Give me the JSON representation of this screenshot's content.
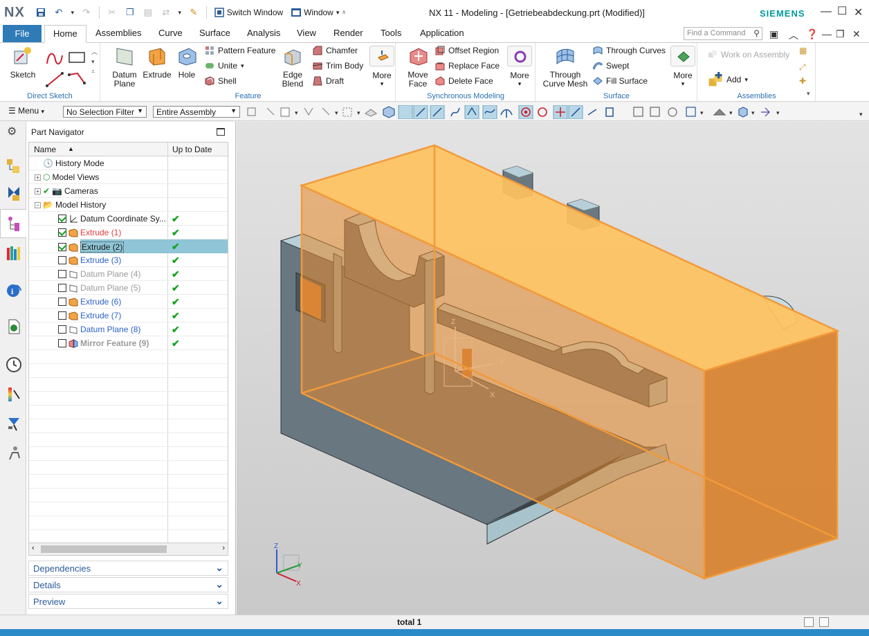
{
  "window": {
    "logo": "NX",
    "title": "NX 11 - Modeling - [Getriebeabdeckung.prt (Modified)]",
    "brand": "SIEMENS",
    "switch_window": "Switch Window",
    "window_menu": "Window",
    "accent_color": "#2e7bb8"
  },
  "tabs": {
    "file": "File",
    "items": [
      "Home",
      "Assemblies",
      "Curve",
      "Surface",
      "Analysis",
      "View",
      "Render",
      "Tools",
      "Application"
    ],
    "active": "Home",
    "find_placeholder": "Find a Command"
  },
  "ribbon": {
    "direct_sketch": {
      "label": "Direct Sketch",
      "sketch": "Sketch"
    },
    "feature": {
      "label": "Feature",
      "datum_plane": "Datum\nPlane",
      "extrude": "Extrude",
      "hole": "Hole",
      "pattern_feature": "Pattern Feature",
      "unite": "Unite",
      "shell": "Shell",
      "edge_blend": "Edge\nBlend",
      "chamfer": "Chamfer",
      "trim_body": "Trim Body",
      "draft": "Draft",
      "more": "More"
    },
    "sync": {
      "label": "Synchronous Modeling",
      "move_face": "Move\nFace",
      "offset_region": "Offset Region",
      "replace_face": "Replace Face",
      "delete_face": "Delete Face",
      "more": "More"
    },
    "surface": {
      "label": "Surface",
      "through_curve_mesh": "Through\nCurve Mesh",
      "through_curves": "Through Curves",
      "swept": "Swept",
      "fill_surface": "Fill Surface",
      "more": "More"
    },
    "assemblies": {
      "label": "Assemblies",
      "work_on_assembly": "Work on Assembly",
      "add": "Add"
    }
  },
  "selection_bar": {
    "menu": "Menu",
    "filter": "No Selection Filter",
    "scope": "Entire Assembly"
  },
  "navigator": {
    "title": "Part Navigator",
    "col_name": "Name",
    "col_up_to_date": "Up to Date",
    "rows": [
      {
        "label": "History Mode",
        "style": "normal",
        "tick": false
      },
      {
        "label": "Model Views",
        "style": "normal",
        "tick": false
      },
      {
        "label": "Cameras",
        "style": "normal",
        "tick": false
      },
      {
        "label": "Model History",
        "style": "normal",
        "tick": false
      },
      {
        "label": "Datum Coordinate Sy...",
        "style": "normal",
        "tick": true
      },
      {
        "label": "Extrude (1)",
        "style": "red",
        "tick": true
      },
      {
        "label": "Extrude (2)",
        "style": "selected",
        "tick": true
      },
      {
        "label": "Extrude (3)",
        "style": "blue",
        "tick": true
      },
      {
        "label": "Datum Plane (4)",
        "style": "gray",
        "tick": true
      },
      {
        "label": "Datum Plane (5)",
        "style": "gray",
        "tick": true
      },
      {
        "label": "Extrude (6)",
        "style": "blue",
        "tick": true
      },
      {
        "label": "Extrude (7)",
        "style": "blue",
        "tick": true
      },
      {
        "label": "Datum Plane (8)",
        "style": "blue",
        "tick": true
      },
      {
        "label": "Mirror Feature (9)",
        "style": "boldgray",
        "tick": true
      }
    ],
    "panels": [
      "Dependencies",
      "Details",
      "Preview"
    ]
  },
  "viewport": {
    "triad_x": "X",
    "triad_y": "Y",
    "triad_z": "Z",
    "highlight_color": "#f29a3a"
  },
  "status": {
    "text": "total 1"
  }
}
